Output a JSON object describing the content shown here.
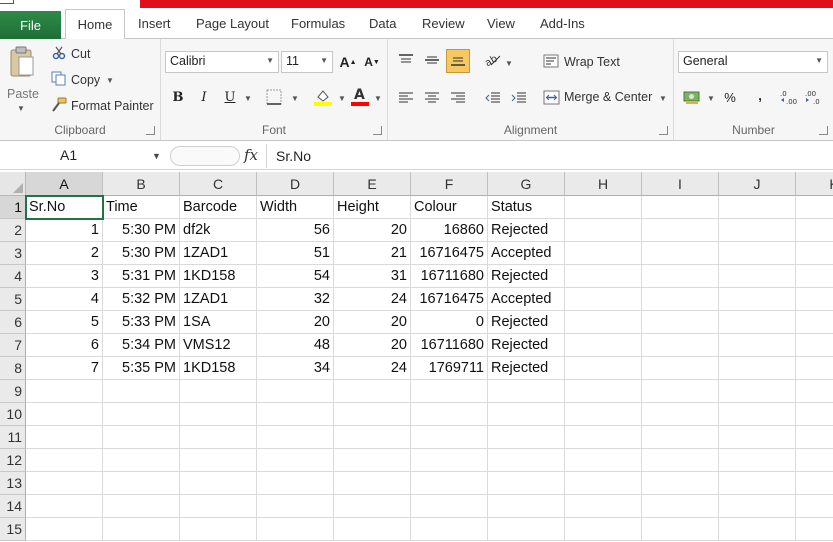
{
  "tabs": {
    "file": "File",
    "home": "Home",
    "insert": "Insert",
    "page_layout": "Page Layout",
    "formulas": "Formulas",
    "data": "Data",
    "review": "Review",
    "view": "View",
    "add_ins": "Add-Ins"
  },
  "clipboard": {
    "paste": "Paste",
    "cut": "Cut",
    "copy": "Copy",
    "format_painter": "Format Painter",
    "label": "Clipboard"
  },
  "font": {
    "name": "Calibri",
    "size": "11",
    "bold": "B",
    "italic": "I",
    "underline": "U",
    "grow": "A",
    "shrink": "A",
    "label": "Font",
    "fill_color": "#ffff00",
    "font_color": "#ff0000"
  },
  "alignment": {
    "wrap_text": "Wrap Text",
    "merge_center": "Merge & Center",
    "label": "Alignment"
  },
  "number": {
    "format": "General",
    "percent": "%",
    "comma": ",",
    "label": "Number"
  },
  "formula_bar": {
    "name_box": "A1",
    "fx": "fx",
    "value": "Sr.No"
  },
  "sheet": {
    "columns": [
      "A",
      "B",
      "C",
      "D",
      "E",
      "F",
      "G",
      "H",
      "I",
      "J",
      "K"
    ],
    "rows": [
      "1",
      "2",
      "3",
      "4",
      "5",
      "6",
      "7",
      "8",
      "9",
      "10",
      "11",
      "12",
      "13",
      "14",
      "15"
    ],
    "data": [
      [
        "Sr.No",
        "Time",
        "Barcode",
        "Width",
        "Height",
        "Colour",
        "Status"
      ],
      [
        "1",
        "5:30 PM",
        "df2k",
        "56",
        "20",
        "16860",
        "Rejected"
      ],
      [
        "2",
        "5:30 PM",
        "1ZAD1",
        "51",
        "21",
        "16716475",
        "Accepted"
      ],
      [
        "3",
        "5:31 PM",
        "1KD158",
        "54",
        "31",
        "16711680",
        "Rejected"
      ],
      [
        "4",
        "5:32 PM",
        "1ZAD1",
        "32",
        "24",
        "16716475",
        "Accepted"
      ],
      [
        "5",
        "5:33 PM",
        "1SA",
        "20",
        "20",
        "0",
        "Rejected"
      ],
      [
        "6",
        "5:34 PM",
        "VMS12",
        "48",
        "20",
        "16711680",
        "Rejected"
      ],
      [
        "7",
        "5:35 PM",
        "1KD158",
        "34",
        "24",
        "1769711",
        "Rejected"
      ]
    ],
    "active_cell": "A1"
  },
  "colors": {
    "file_tab": "#217346",
    "title_strip": "#e0101a",
    "active_highlight": "#f5c862"
  }
}
